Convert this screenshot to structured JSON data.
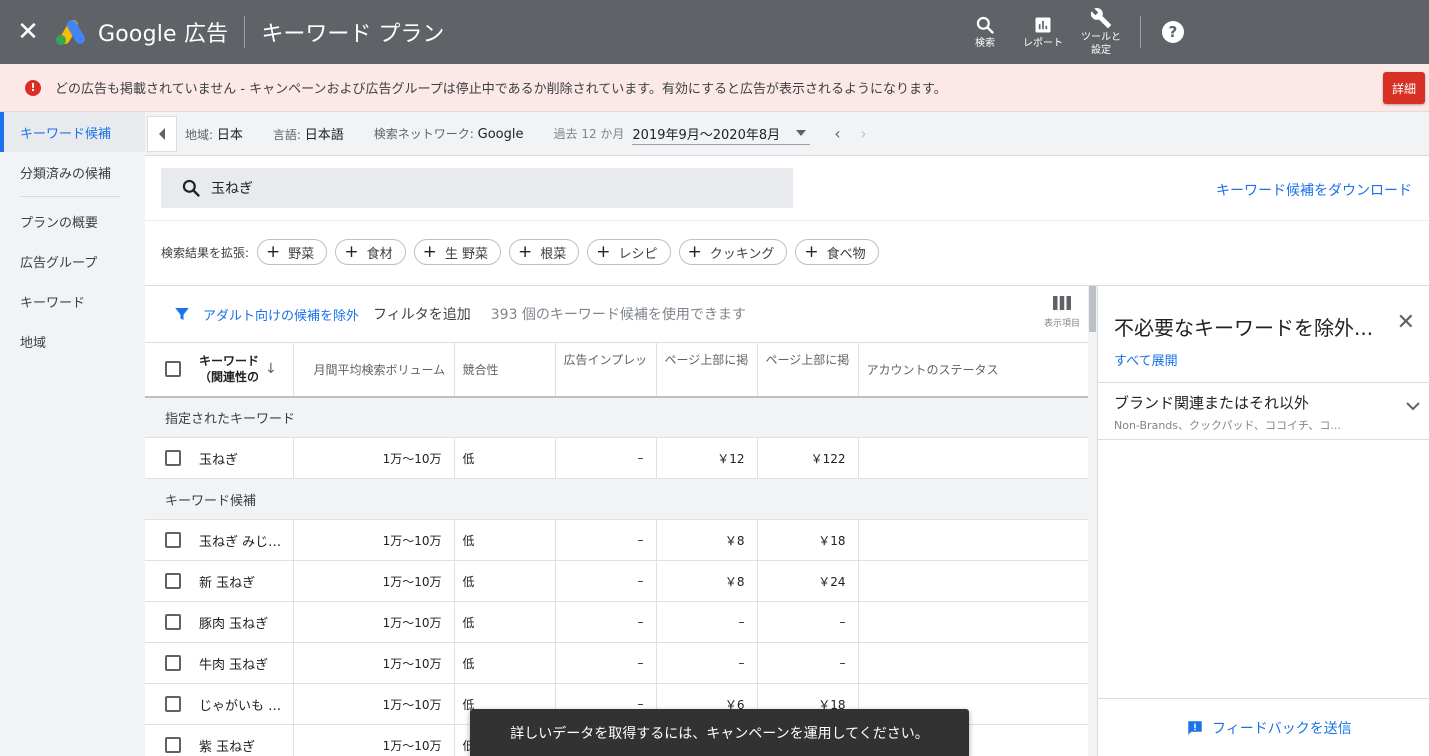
{
  "topbar": {
    "brand": "Google 広告",
    "title": "キーワード プラン",
    "buttons": [
      {
        "label": "検索",
        "icon": "search-icon"
      },
      {
        "label": "レポート",
        "icon": "bar-chart-icon"
      },
      {
        "label_line1": "ツールと",
        "label_line2": "設定",
        "icon": "wrench-icon"
      }
    ],
    "help": "?"
  },
  "alert": {
    "text": "どの広告も掲載されていません - キャンペーンおよび広告グループは停止中であるか削除されています。有効にすると広告が表示されるようになります。",
    "button": "詳細",
    "color": "#d93025"
  },
  "leftnav": {
    "items": [
      "キーワード候補",
      "分類済みの候補",
      "プランの概要",
      "広告グループ",
      "キーワード",
      "地域"
    ],
    "active": "キーワード候補"
  },
  "filterbar": {
    "location_label": "地域:",
    "location": "日本",
    "language_label": "言語:",
    "language": "日本語",
    "network_label": "検索ネットワーク:",
    "network": "Google",
    "period_label": "過去 12 か月",
    "period": "2019年9月～2020年8月"
  },
  "search": {
    "query": "玉ねぎ",
    "download": "キーワード候補をダウンロード",
    "expand_label": "検索結果を拡張:",
    "chips": [
      "野菜",
      "食材",
      "生 野菜",
      "根菜",
      "レシピ",
      "クッキング",
      "食べ物"
    ]
  },
  "table_toolbar": {
    "adult_filter": "アダルト向けの候補を除外",
    "add_filter": "フィルタを追加",
    "count": "393 個のキーワード候補を使用できます",
    "columns_label": "表示項目"
  },
  "table": {
    "headers": {
      "keyword_line1": "キーワード",
      "keyword_line2": "（関連性の",
      "volume": "月間平均検索ボリューム",
      "competition": "競合性",
      "impression_share": "広告インプレッ",
      "top_bid_low": "ページ上部に掲",
      "top_bid_high": "ページ上部に掲",
      "status": "アカウントのステータス"
    },
    "group_provided": "指定されたキーワード",
    "provided_rows": [
      {
        "keyword": "玉ねぎ",
        "volume": "1万～10万",
        "competition": "低",
        "share": "–",
        "low": "￥12",
        "high": "￥122"
      }
    ],
    "group_ideas": "キーワード候補",
    "idea_rows": [
      {
        "keyword": "玉ねぎ みじん...",
        "volume": "1万～10万",
        "competition": "低",
        "share": "–",
        "low": "￥8",
        "high": "￥18"
      },
      {
        "keyword": "新 玉ねぎ",
        "volume": "1万～10万",
        "competition": "低",
        "share": "–",
        "low": "￥8",
        "high": "￥24"
      },
      {
        "keyword": "豚肉 玉ねぎ",
        "volume": "1万～10万",
        "competition": "低",
        "share": "–",
        "low": "–",
        "high": "–"
      },
      {
        "keyword": "牛肉 玉ねぎ",
        "volume": "1万～10万",
        "competition": "低",
        "share": "–",
        "low": "–",
        "high": "–"
      },
      {
        "keyword": "じゃがいも 玉...",
        "volume": "1万～10万",
        "competition": "低",
        "share": "–",
        "low": "￥6",
        "high": "￥18"
      },
      {
        "keyword": "紫 玉ねぎ",
        "volume": "1万～10万",
        "competition": "低",
        "share": "–",
        "low": "–",
        "high": "–"
      }
    ]
  },
  "rightpanel": {
    "title": "不必要なキーワードを除外...",
    "expand_all": "すべて展開",
    "group_title": "ブランド関連またはそれ以外",
    "group_sub": "Non-Brands、クックパッド、ココイチ、コ...",
    "feedback": "フィードバックを送信"
  },
  "snackbar": {
    "text": "詳しいデータを取得するには、キャンペーンを運用してください。"
  }
}
